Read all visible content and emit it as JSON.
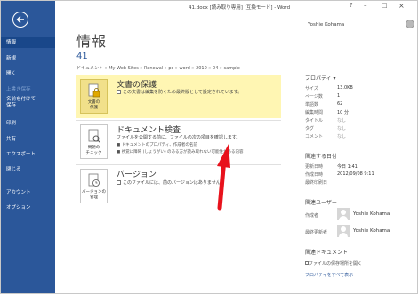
{
  "window": {
    "title": "41.docx [読み取り専用] [互換モード] - Word",
    "help": "?",
    "minimize": "–",
    "restore": "□",
    "close": "×",
    "user": "Yoshie Kohama"
  },
  "sidebar": {
    "items": [
      {
        "label": "情報"
      },
      {
        "label": "新規"
      },
      {
        "label": "開く"
      },
      {
        "label": "上書き保存"
      },
      {
        "label": "名前を付けて\n保存"
      },
      {
        "label": "印刷"
      },
      {
        "label": "共有"
      },
      {
        "label": "エクスポート"
      },
      {
        "label": "閉じる"
      },
      {
        "label": "アカウント"
      },
      {
        "label": "オプション"
      }
    ]
  },
  "main": {
    "title": "情報",
    "doc_name": "41",
    "breadcrumb": "ドキュメント » My Web Sites » Renewal » pc » word » 2010 » 04 » sample",
    "protect": {
      "tile_label": "文書の\n保護",
      "title": "文書の保護",
      "desc": "この文書は編集を防ぐため最終版として設定されています。"
    },
    "inspect": {
      "tile_label": "問題の\nチェック",
      "title": "ドキュメント検査",
      "desc": "ファイルを公開する前に、ファイルの次の項目を確認します。",
      "bullet1": "ドキュメントのプロパティ、作成者の名前",
      "bullet2": "視覚に障碍 (しょうがい) のある方が読み取れない可能性がある内容"
    },
    "version": {
      "tile_label": "バージョンの\n管理",
      "title": "バージョン",
      "desc": "このファイルには、前のバージョンはありません。"
    }
  },
  "properties": {
    "heading": "プロパティ",
    "rows": [
      {
        "k": "サイズ",
        "v": "13.0KB"
      },
      {
        "k": "ページ数",
        "v": "1"
      },
      {
        "k": "単語数",
        "v": "62"
      },
      {
        "k": "編集時間",
        "v": "10 分"
      },
      {
        "k": "タイトル",
        "v": "なし"
      },
      {
        "k": "タグ",
        "v": "なし"
      },
      {
        "k": "コメント",
        "v": "なし"
      }
    ]
  },
  "dates": {
    "heading": "関連する日付",
    "rows": [
      {
        "k": "更新日時",
        "v": "今日 1:41"
      },
      {
        "k": "作成日時",
        "v": "2012/09/08 9:11"
      },
      {
        "k": "最終印刷日",
        "v": ""
      }
    ]
  },
  "people": {
    "heading": "関連ユーザー",
    "author_label": "作成者",
    "author": "Yoshie Kohama",
    "modifier_label": "最終更新者",
    "modifier": "Yoshie Kohama"
  },
  "related_docs": {
    "heading": "関連ドキュメント",
    "open_folder": "ファイルの保存場所を開く",
    "show_all": "プロパティをすべて表示"
  },
  "colors": {
    "sidebar": "#2b579a",
    "protect_bg": "#fff6b3",
    "arrow": "#e8121c"
  }
}
